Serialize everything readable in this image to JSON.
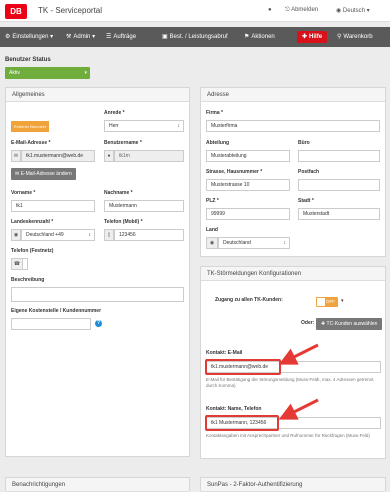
{
  "header": {
    "logo": "DB",
    "title": "TK - Serviceportal",
    "logout": "Abmelden",
    "language": "Deutsch"
  },
  "nav": {
    "einstellungen": "Einstellungen",
    "admin": "Admin",
    "auftraege": "Aufträge",
    "bestellung": "Best. / Leistungsabruf",
    "aktionen": "Aktionen",
    "hilfe": "Hilfe",
    "warenkorb": "Warenkorb"
  },
  "status": {
    "label": "Benutzer Status",
    "value": "Aktiv"
  },
  "allgemeines": {
    "title": "Allgemeines",
    "badge": "Externer Benutzer",
    "anrede_label": "Anrede *",
    "anrede_value": "Herr",
    "email_label": "E-Mail-Adresse *",
    "email_value": "tk1.mustermann@web.de",
    "benutzername_label": "Benutzername *",
    "benutzername_value": "tk1m",
    "email_change_button": "E-Mail-Adresse ändern",
    "vorname_label": "Vorname *",
    "vorname_value": "tk1",
    "nachname_label": "Nachname *",
    "nachname_value": "Mustermann",
    "landeskennzahl_label": "Landeskennzahl *",
    "landeskennzahl_value": "Deutschland +49",
    "mobil_label": "Telefon (Mobil) *",
    "mobil_value": "123456",
    "festnetz_label": "Telefon (Festnetz)",
    "festnetz_value": "",
    "beschreibung_label": "Beschreibung",
    "beschreibung_value": "",
    "kostenstelle_label": "Eigene Kostenstelle / Kundennummer",
    "kostenstelle_value": ""
  },
  "adresse": {
    "title": "Adresse",
    "firma_label": "Firma *",
    "firma_value": "Musterfirma",
    "abteilung_label": "Abteilung",
    "abteilung_value": "Musterabteilung",
    "buero_label": "Büro",
    "buero_value": "",
    "strasse_label": "Strasse, Hausnummer *",
    "strasse_value": "Musterstrasse 10",
    "postfach_label": "Postfach",
    "postfach_value": "",
    "plz_label": "PLZ *",
    "plz_value": "99999",
    "stadt_label": "Stadt *",
    "stadt_value": "Musterstadt",
    "land_label": "Land",
    "land_value": "Deutschland"
  },
  "tk_config": {
    "title": "TK-Störmeldungen Konfigurationen",
    "zugang_label": "Zugang zu allen TK-Kunden:",
    "zugang_toggle": "OFF",
    "oder_label": "Oder:",
    "tc_button": "TC-Kunden auswählen",
    "kontakt_email_label": "Kontakt: E-Mail",
    "kontakt_email_value": "tk1.mustermann@web.de",
    "kontakt_email_help": "E-Mail für Bestätigung der Störungsmeldung (Muss-Feld!, max. 4 Adressen getrennt durch Komma)",
    "kontakt_name_label": "Kontakt: Name, Telefon",
    "kontakt_name_value": "tk1 Mustermann, 123456",
    "kontakt_name_help": "Kontaktangaben mit Ansprechpartner und Rufnummer für Rückfragen (Muss-Feld)"
  },
  "bottom": {
    "benachrichtigungen": "Benachrichtigungen",
    "sunpas": "SunPas - 2-Faktor-Authentifizierung"
  },
  "colors": {
    "db_red": "#ec0016",
    "status_green": "#6fae3c",
    "badge_orange": "#f0a33a",
    "annotation_red": "#e53935"
  }
}
